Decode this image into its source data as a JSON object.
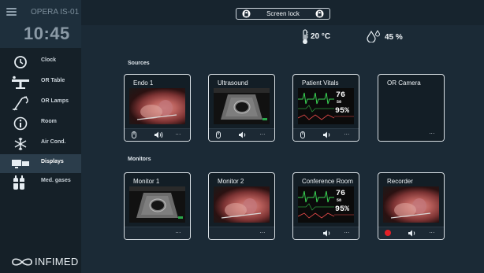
{
  "sidebar": {
    "room_name": "OPERA IS-01",
    "time": "10:45",
    "items": [
      {
        "label": "Clock",
        "icon": "clock-icon"
      },
      {
        "label": "OR Table",
        "icon": "or-table-icon"
      },
      {
        "label": "OR Lamps",
        "icon": "lamp-icon"
      },
      {
        "label": "Room",
        "icon": "info-icon"
      },
      {
        "label": "Air Cond.",
        "icon": "snowflake-icon"
      },
      {
        "label": "Displays",
        "icon": "displays-icon",
        "active": true
      },
      {
        "label": "Med. gases",
        "icon": "gas-cylinders-icon"
      }
    ],
    "logo_text": "INFIMED"
  },
  "topbar": {
    "screen_lock_label": "Screen lock"
  },
  "climate": {
    "temperature": "20 °C",
    "humidity": "45 %"
  },
  "sources": {
    "title": "Sources",
    "cards": [
      {
        "title": "Endo 1",
        "thumbnail": "endoscope-view",
        "actions": [
          "mouse-icon",
          "speaker-icon",
          "more-icon"
        ]
      },
      {
        "title": "Ultrasound",
        "thumbnail": "ultrasound-view",
        "actions": [
          "mouse-icon",
          "speaker-icon",
          "more-icon"
        ]
      },
      {
        "title": "Patient Vitals",
        "thumbnail": "vitals-monitor-view",
        "actions": [
          "mouse-icon",
          "speaker-icon",
          "more-icon"
        ]
      },
      {
        "title": "OR Camera",
        "thumbnail": "none",
        "actions": [
          "more-icon"
        ]
      }
    ]
  },
  "monitors": {
    "title": "Monitors",
    "cards": [
      {
        "title": "Monitor 1",
        "thumbnail": "ultrasound-view",
        "actions": [
          "more-icon"
        ]
      },
      {
        "title": "Monitor 2",
        "thumbnail": "endoscope-view",
        "actions": [
          "more-icon"
        ]
      },
      {
        "title": "Conference Room",
        "thumbnail": "vitals-monitor-view",
        "actions": [
          "speaker-icon",
          "more-icon"
        ]
      },
      {
        "title": "Recorder",
        "thumbnail": "endoscope-view",
        "actions": [
          "record-icon",
          "speaker-icon",
          "more-icon"
        ]
      }
    ]
  },
  "vitals_display": {
    "heart_rate": "76",
    "heart_rate_sub": "58",
    "spo2": "95%"
  },
  "more_label": "...",
  "colors": {
    "background": "#1b2a36",
    "sidebar": "#152028",
    "active_item": "#2b3d4b",
    "card_border": "#d8dfe4",
    "record_red": "#e21f26",
    "ecg_green": "#39d353"
  }
}
